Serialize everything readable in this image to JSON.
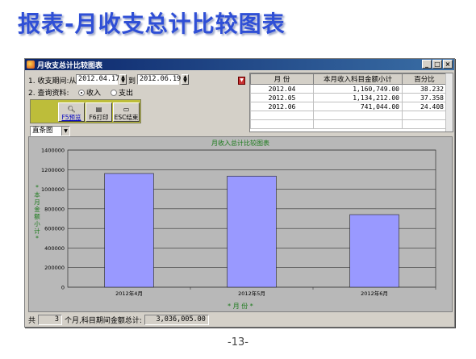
{
  "slide": {
    "title": "报表-月收支总计比较图表",
    "page": "-13-"
  },
  "window": {
    "title": "月收支总计比较图表",
    "buttons": {
      "minimize": "_",
      "maximize": "□",
      "close": "×"
    }
  },
  "filters": {
    "period_label": "1. 收支期间:从",
    "date_from": "2012.04.17",
    "to_label": "到",
    "date_to": "2012.06.19",
    "query_label": "2. 查询资料:",
    "income_label": "收入",
    "expense_label": "支出",
    "selected": "income"
  },
  "toolbar": {
    "preview": "F5预览",
    "print": "F6打印",
    "exit": "ESC结束"
  },
  "chart_type_select": "直条图",
  "table": {
    "headers": [
      "月 份",
      "本月收入科目金额小计",
      "百分比"
    ],
    "rows": [
      [
        "2012.04",
        "1,160,749.00",
        "38.232"
      ],
      [
        "2012.05",
        "1,134,212.00",
        "37.358"
      ],
      [
        "2012.06",
        "741,044.00",
        "24.408"
      ]
    ]
  },
  "chart_data": {
    "type": "bar",
    "title": "月收入总计比较图表",
    "categories": [
      "2012年4月",
      "2012年5月",
      "2012年6月"
    ],
    "values": [
      1160749,
      1134212,
      741044
    ],
    "xlabel": "* 月 份 *",
    "ylabel": "*本月金额小计*",
    "ylim": [
      0,
      1400000
    ],
    "yticks": [
      0,
      200000,
      400000,
      600000,
      800000,
      1000000,
      1200000,
      1400000
    ],
    "bar_color": "#9999ff",
    "grid": true
  },
  "status": {
    "prefix": "共",
    "count": "3",
    "suffix": "个月,科目期间金额总计:",
    "total": "3,036,005.00"
  }
}
